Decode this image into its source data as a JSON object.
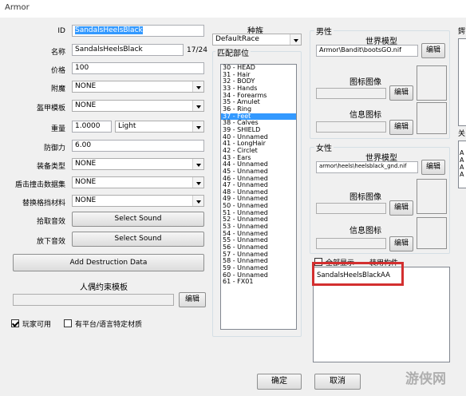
{
  "window": {
    "title": "Armor"
  },
  "fields": {
    "id_label": "ID",
    "id_value": "SandalsHeelsBlack",
    "name_label": "名称",
    "name_value": "SandalsHeelsBlack",
    "name_count": "17/24",
    "price_label": "价格",
    "price_value": "100",
    "enchant_label": "附魔",
    "enchant_value": "NONE",
    "armor_template_label": "盔甲模板",
    "armor_template_value": "NONE",
    "weight_label": "重量",
    "weight_value": "1.0000",
    "armor_type_value": "Light",
    "armor_rating_label": "防御力",
    "armor_rating_value": "6.00",
    "equip_type_label": "装备类型",
    "equip_type_value": "NONE",
    "block_impact_label": "盾击撞击数据集",
    "block_impact_value": "NONE",
    "alt_block_label": "替换格挡材料",
    "alt_block_value": "NONE",
    "pickup_sound_label": "拾取音效",
    "pickup_sound_button": "Select Sound",
    "putdown_sound_label": "放下音效",
    "putdown_sound_button": "Select Sound",
    "add_destruction_button": "Add Destruction Data",
    "ragdoll_label": "人偶约束模板",
    "ragdoll_edit": "编辑",
    "playable_label": "玩家可用",
    "playable_checked": true,
    "platform_label": "有平台/语言特定材质",
    "platform_checked": false
  },
  "race": {
    "label": "种族",
    "value": "DefaultRace",
    "slots_label": "匹配部位",
    "slots": [
      "30 - HEAD",
      "31 - Hair",
      "32 - BODY",
      "33 - Hands",
      "34 - Forearms",
      "35 - Amulet",
      "36 - Ring",
      "37 - Feet",
      "38 - Calves",
      "39 - SHIELD",
      "40 - Unnamed",
      "41 - LongHair",
      "42 - Circlet",
      "43 - Ears",
      "44 - Unnamed",
      "45 - Unnamed",
      "46 - Unnamed",
      "47 - Unnamed",
      "48 - Unnamed",
      "49 - Unnamed",
      "50 - Unnamed",
      "51 - Unnamed",
      "52 - Unnamed",
      "53 - Unnamed",
      "54 - Unnamed",
      "55 - Unnamed",
      "56 - Unnamed",
      "57 - Unnamed",
      "58 - Unnamed",
      "59 - Unnamed",
      "60 - Unnamed",
      "61 - FX01"
    ],
    "selected_index": 7
  },
  "male": {
    "label": "男性",
    "world_model_label": "世界模型",
    "world_model_value": "Armor\\Bandit\\bootsGO.nif",
    "edit": "编辑",
    "icon_label": "图标图像",
    "message_icon_label": "信息图标"
  },
  "female": {
    "label": "女性",
    "world_model_label": "世界模型",
    "world_model_value": "armor\\heels\\heelsblack_gnd.nif",
    "edit": "编辑",
    "icon_label": "图标图像",
    "message_icon_label": "信息图标"
  },
  "addons": {
    "show_all_label": "全部显示",
    "addon_label": "装用构件",
    "items": [
      "SandalsHeelsBlackAA"
    ]
  },
  "right_partial": {
    "top_char": "鍔",
    "mid_char": "关",
    "letters": [
      "A",
      "A",
      "A",
      "A"
    ]
  },
  "footer": {
    "ok": "确定",
    "cancel": "取消"
  },
  "watermark": "游侠网",
  "colors": {
    "selection": "#3399ff",
    "highlight_box": "#d32f2f"
  }
}
